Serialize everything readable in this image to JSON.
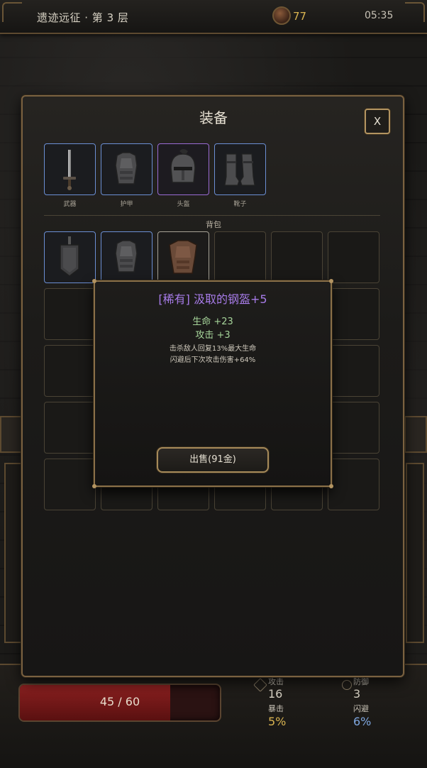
{
  "topbar": {
    "title": "遗迹远征 · 第 3 层",
    "gold": "77",
    "clock": "05:35"
  },
  "panel": {
    "title": "装备",
    "close_label": "X",
    "equipped": [
      {
        "label": "武器",
        "icon": "sword-icon",
        "rarity": "blue"
      },
      {
        "label": "护甲",
        "icon": "armor-icon",
        "rarity": "blue"
      },
      {
        "label": "头盔",
        "icon": "helmet-icon",
        "rarity": "purple"
      },
      {
        "label": "靴子",
        "icon": "boots-icon",
        "rarity": "blue"
      }
    ],
    "bag_label": "背包",
    "bag_items": [
      {
        "icon": "shield-icon",
        "rarity": "blue"
      },
      {
        "icon": "armor-icon",
        "rarity": "blue"
      },
      {
        "icon": "leather-armor-icon",
        "rarity": "white"
      }
    ]
  },
  "tooltip": {
    "title": "[稀有] 汲取的钢盔+5",
    "stat1": "生命 +23",
    "stat2": "攻击 +3",
    "desc1": "击杀敌人回复13%最大生命",
    "desc2": "闪避后下次攻击伤害+64%",
    "sell_label": "出售(91金)"
  },
  "hud": {
    "hp_text": "45 / 60",
    "hp_fraction": 0.75,
    "attack_label": "攻击",
    "attack_value": "16",
    "defense_label": "防御",
    "defense_value": "3",
    "crit_label": "暴击",
    "crit_value": "5%",
    "dodge_label": "闪避",
    "dodge_value": "6%"
  },
  "colors": {
    "rare_purple": "#a77be8",
    "magic_blue": "#6b8fd4",
    "gold": "#d9b451",
    "stat_green": "#a6d49a"
  }
}
